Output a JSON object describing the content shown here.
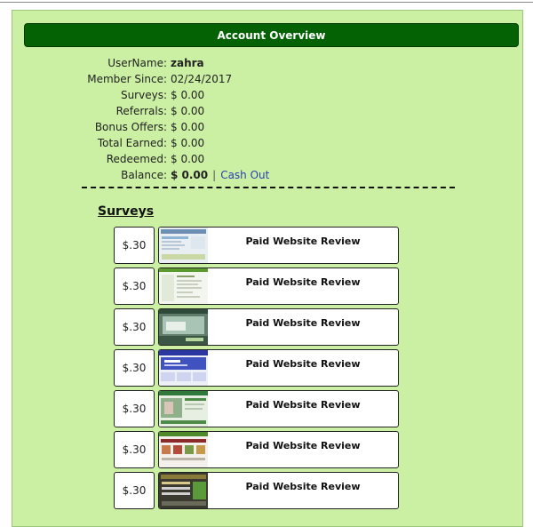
{
  "header": {
    "title": "Account Overview"
  },
  "account": {
    "rows": [
      {
        "label": "UserName:",
        "value": "zahra"
      },
      {
        "label": "Member Since:",
        "value": "02/24/2017"
      },
      {
        "label": "Surveys:",
        "value": "$ 0.00"
      },
      {
        "label": "Referrals:",
        "value": "$ 0.00"
      },
      {
        "label": "Bonus Offers:",
        "value": "$ 0.00"
      },
      {
        "label": "Total Earned:",
        "value": "$ 0.00"
      },
      {
        "label": "Redeemed:",
        "value": "$ 0.00"
      }
    ],
    "balance": {
      "label": "Balance:",
      "value": "$ 0.00",
      "separator": "|",
      "cash_out": "Cash Out"
    }
  },
  "surveys": {
    "title": "Surveys",
    "items": [
      {
        "price": "$.30",
        "title": "Paid Website Review",
        "thumb_style": "site-white"
      },
      {
        "price": "$.30",
        "title": "Paid Website Review",
        "thumb_style": "site-greenbar"
      },
      {
        "price": "$.30",
        "title": "Paid Website Review",
        "thumb_style": "site-photo"
      },
      {
        "price": "$.30",
        "title": "Paid Website Review",
        "thumb_style": "site-blue"
      },
      {
        "price": "$.30",
        "title": "Paid Website Review",
        "thumb_style": "site-green"
      },
      {
        "price": "$.30",
        "title": "Paid Website Review",
        "thumb_style": "site-shop"
      },
      {
        "price": "$.30",
        "title": "Paid Website Review",
        "thumb_style": "site-dark"
      }
    ]
  }
}
